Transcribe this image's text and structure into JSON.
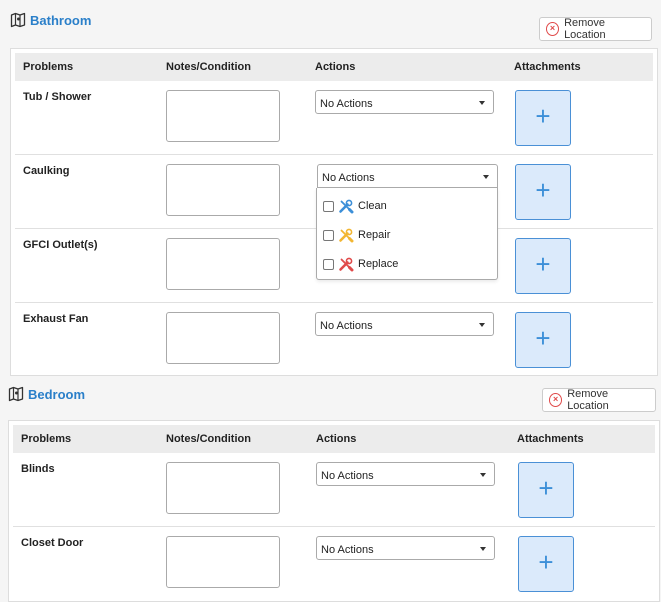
{
  "columns": {
    "problems": "Problems",
    "notes": "Notes/Condition",
    "actions": "Actions",
    "attachments": "Attachments"
  },
  "locations": [
    {
      "title": "Bathroom",
      "remove_label": "Remove Location",
      "rows": [
        {
          "problem": "Tub / Shower",
          "action": "No Actions"
        },
        {
          "problem": "Caulking",
          "action": "No Actions"
        },
        {
          "problem": "GFCI Outlet(s)",
          "action": ""
        },
        {
          "problem": "Exhaust Fan",
          "action": "No Actions"
        }
      ]
    },
    {
      "title": "Bedroom",
      "remove_label": "Remove Location",
      "rows": [
        {
          "problem": "Blinds",
          "action": "No Actions"
        },
        {
          "problem": "Closet Door",
          "action": "No Actions"
        }
      ]
    }
  ],
  "attach_symbol": "+",
  "remove_symbol": "×",
  "dropdown": {
    "options": [
      {
        "label": "Clean",
        "icon": "wrench-screwdriver-icon",
        "color": "#3c8fd8",
        "checked": false
      },
      {
        "label": "Repair",
        "icon": "wrench-screwdriver-icon",
        "color": "#f2b632",
        "checked": false
      },
      {
        "label": "Replace",
        "icon": "wrench-screwdriver-icon",
        "color": "#e04a4a",
        "checked": false
      }
    ]
  },
  "colors": {
    "title": "#2a7fc9",
    "attach_bg": "#dbeafb",
    "attach_border": "#4a90d6",
    "remove_icon": "#e04a4a"
  }
}
